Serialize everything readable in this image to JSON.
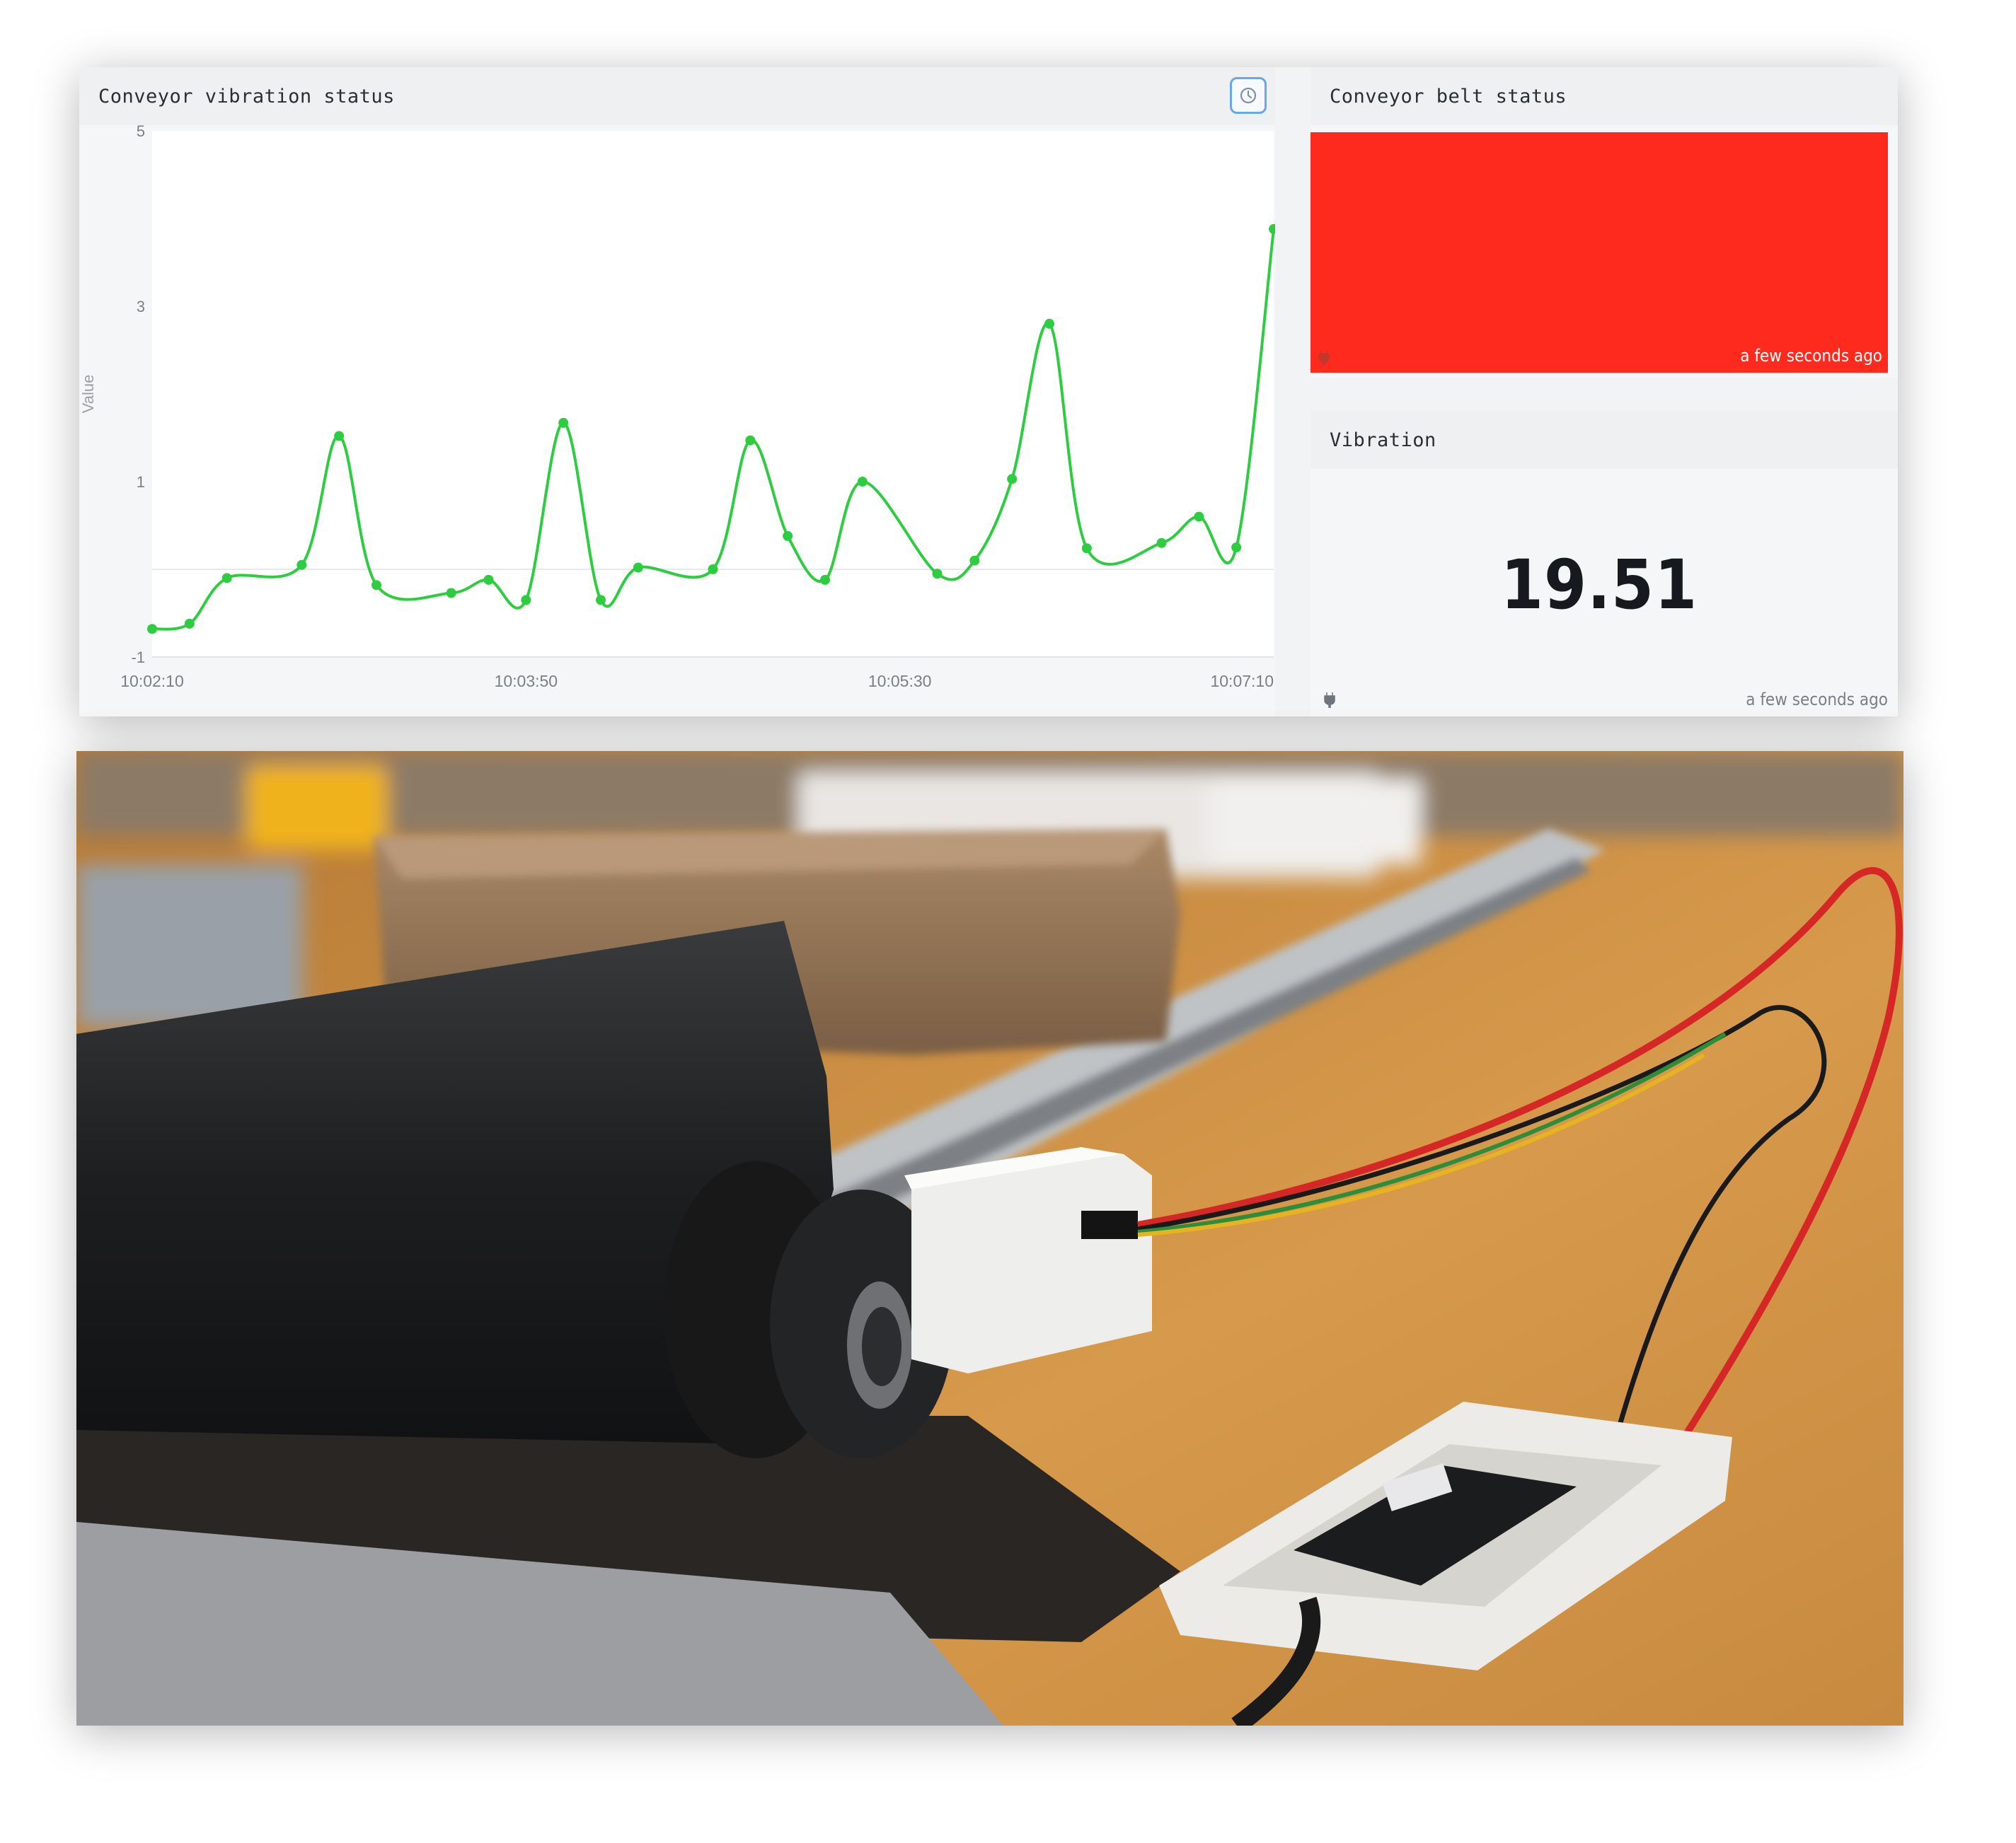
{
  "dashboard": {
    "vibration_chart_panel": {
      "title": "Conveyor vibration status",
      "time_range_button_icon": "clock-icon"
    },
    "belt_status_panel": {
      "title": "Conveyor belt status",
      "status_color": "#ff2a1e",
      "updated": "a few seconds ago",
      "source_icon": "plug-icon"
    },
    "vibration_panel": {
      "title": "Vibration",
      "value": "19.51",
      "updated": "a few seconds ago",
      "source_icon": "plug-icon"
    }
  },
  "chart_data": {
    "type": "line",
    "title": "Conveyor vibration status",
    "xlabel": "",
    "ylabel": "Value",
    "ylim": [
      -1,
      5
    ],
    "y_ticks": [
      "5",
      "3",
      "1",
      "-1"
    ],
    "x_tick_labels": [
      "10:02:10",
      "10:03:50",
      "10:05:30",
      "10:07:10"
    ],
    "x": [
      "10:02:10",
      "10:02:20",
      "10:02:30",
      "10:02:50",
      "10:03:00",
      "10:03:10",
      "10:03:30",
      "10:03:40",
      "10:03:50",
      "10:04:00",
      "10:04:10",
      "10:04:20",
      "10:04:40",
      "10:04:50",
      "10:05:00",
      "10:05:10",
      "10:05:20",
      "10:05:40",
      "10:05:50",
      "10:06:00",
      "10:06:10",
      "10:06:20",
      "10:06:40",
      "10:06:50",
      "10:07:00",
      "10:07:10"
    ],
    "series": [
      {
        "color": "#2ecc40",
        "values": [
          -0.68,
          -0.62,
          -0.1,
          0.05,
          1.52,
          -0.18,
          -0.27,
          -0.12,
          -0.35,
          1.67,
          -0.35,
          0.02,
          0.0,
          1.47,
          0.38,
          -0.12,
          1.0,
          -0.05,
          0.1,
          1.03,
          2.8,
          0.24,
          0.3,
          0.6,
          0.25,
          3.88
        ]
      }
    ],
    "grid": "horizontal line at 0",
    "line_color": "#2ecc40"
  },
  "photo": {
    "subject": "conveyor-with-vibration-sensor"
  }
}
